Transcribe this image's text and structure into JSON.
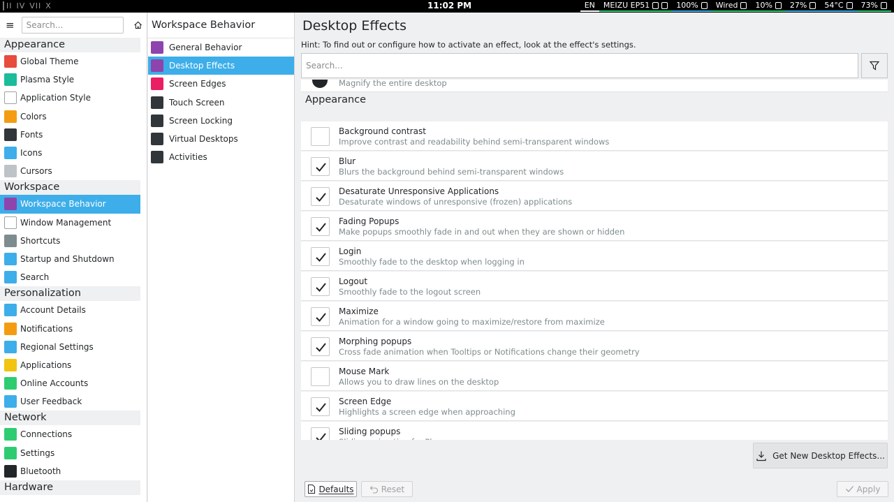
{
  "topbar": {
    "workspaces": [
      "II",
      "IV",
      "VII",
      "X"
    ],
    "clock": "11:02 PM",
    "tray": [
      {
        "name": "keyboard-layout",
        "text": "EN",
        "icon": "",
        "bar": "#ffffff"
      },
      {
        "name": "bluetooth-device",
        "text": "MEIZU EP51",
        "icon": "headset-icon bluetooth-icon",
        "bar": "#2ecc71"
      },
      {
        "name": "volume",
        "text": "100%",
        "icon": "speaker-icon",
        "bar": "#3daee9"
      },
      {
        "name": "network",
        "text": "Wired",
        "icon": "wired-icon",
        "bar": "#2ecc71"
      },
      {
        "name": "battery-device",
        "text": "10%",
        "icon": "battery-icon",
        "bar": "#2ecc71"
      },
      {
        "name": "memory",
        "text": "27%",
        "icon": "memory-icon",
        "bar": "#3daee9"
      },
      {
        "name": "temperature",
        "text": "54°C",
        "icon": "thermometer-icon",
        "bar": "#3daee9"
      },
      {
        "name": "battery",
        "text": "73%",
        "icon": "power-icon",
        "bar": "#2ecc71"
      }
    ]
  },
  "sidebar": {
    "search_placeholder": "Search...",
    "groups": [
      {
        "title": "Appearance",
        "items": [
          {
            "label": "Global Theme",
            "icon": "global-theme-icon",
            "color": "#e74c3c"
          },
          {
            "label": "Plasma Style",
            "icon": "plasma-style-icon",
            "color": "#1abc9c"
          },
          {
            "label": "Application Style",
            "icon": "application-style-icon",
            "color": "#ffffff"
          },
          {
            "label": "Colors",
            "icon": "colors-icon",
            "color": "#f39c12"
          },
          {
            "label": "Fonts",
            "icon": "fonts-icon",
            "color": "#31363b"
          },
          {
            "label": "Icons",
            "icon": "icons-icon",
            "color": "#3daee9"
          },
          {
            "label": "Cursors",
            "icon": "cursors-icon",
            "color": "#bdc3c7"
          }
        ]
      },
      {
        "title": "Workspace",
        "items": [
          {
            "label": "Workspace Behavior",
            "icon": "workspace-behavior-icon",
            "color": "#8e44ad",
            "selected": true
          },
          {
            "label": "Window Management",
            "icon": "window-management-icon",
            "color": "#ffffff"
          },
          {
            "label": "Shortcuts",
            "icon": "keyboard-icon",
            "color": "#7f8c8d"
          },
          {
            "label": "Startup and Shutdown",
            "icon": "startup-icon",
            "color": "#3daee9"
          },
          {
            "label": "Search",
            "icon": "search-icon",
            "color": "#3daee9"
          }
        ]
      },
      {
        "title": "Personalization",
        "items": [
          {
            "label": "Account Details",
            "icon": "account-icon",
            "color": "#3daee9"
          },
          {
            "label": "Notifications",
            "icon": "bell-icon",
            "color": "#f39c12"
          },
          {
            "label": "Regional Settings",
            "icon": "regional-icon",
            "color": "#3daee9"
          },
          {
            "label": "Applications",
            "icon": "star-icon",
            "color": "#f1c40f"
          },
          {
            "label": "Online Accounts",
            "icon": "globe-icon",
            "color": "#2ecc71"
          },
          {
            "label": "User Feedback",
            "icon": "feedback-icon",
            "color": "#3daee9"
          }
        ]
      },
      {
        "title": "Network",
        "items": [
          {
            "label": "Connections",
            "icon": "connections-globe-icon",
            "color": "#2ecc71"
          },
          {
            "label": "Settings",
            "icon": "network-settings-icon",
            "color": "#2ecc71"
          },
          {
            "label": "Bluetooth",
            "icon": "bluetooth-icon",
            "color": "#232629"
          }
        ]
      },
      {
        "title": "Hardware",
        "items": []
      }
    ]
  },
  "subnav": {
    "title": "Workspace Behavior",
    "items": [
      {
        "label": "General Behavior",
        "icon": "general-behavior-icon",
        "color": "#8e44ad"
      },
      {
        "label": "Desktop Effects",
        "icon": "desktop-effects-icon",
        "color": "#8e44ad",
        "selected": true
      },
      {
        "label": "Screen Edges",
        "icon": "screen-edges-icon",
        "color": "#e91e63"
      },
      {
        "label": "Touch Screen",
        "icon": "touch-screen-icon",
        "color": "#31363b"
      },
      {
        "label": "Screen Locking",
        "icon": "screen-locking-icon",
        "color": "#31363b"
      },
      {
        "label": "Virtual Desktops",
        "icon": "virtual-desktops-icon",
        "color": "#31363b"
      },
      {
        "label": "Activities",
        "icon": "activities-icon",
        "color": "#31363b"
      }
    ]
  },
  "main": {
    "title": "Desktop Effects",
    "hint": "Hint: To find out or configure how to activate an effect, look at the effect's settings.",
    "search_placeholder": "Search...",
    "prev_desc": "Magnify the entire desktop",
    "group": "Appearance",
    "effects": [
      {
        "name": "Background contrast",
        "desc": "Improve contrast and readability behind semi-transparent windows",
        "checked": false
      },
      {
        "name": "Blur",
        "desc": "Blurs the background behind semi-transparent windows",
        "checked": true
      },
      {
        "name": "Desaturate Unresponsive Applications",
        "desc": "Desaturate windows of unresponsive (frozen) applications",
        "checked": true
      },
      {
        "name": "Fading Popups",
        "desc": "Make popups smoothly fade in and out when they are shown or hidden",
        "checked": true
      },
      {
        "name": "Login",
        "desc": "Smoothly fade to the desktop when logging in",
        "checked": true
      },
      {
        "name": "Logout",
        "desc": "Smoothly fade to the logout screen",
        "checked": true
      },
      {
        "name": "Maximize",
        "desc": "Animation for a window going to maximize/restore from maximize",
        "checked": true
      },
      {
        "name": "Morphing popups",
        "desc": "Cross fade animation when Tooltips or Notifications change their geometry",
        "checked": true
      },
      {
        "name": "Mouse Mark",
        "desc": "Allows you to draw lines on the desktop",
        "checked": false
      },
      {
        "name": "Screen Edge",
        "desc": "Highlights a screen edge when approaching",
        "checked": true
      },
      {
        "name": "Sliding popups",
        "desc": "Sliding animation for Plasma popups",
        "checked": true
      }
    ],
    "get_new_label": "Get New Desktop Effects...",
    "defaults_label": "Defaults",
    "reset_label": "Reset",
    "apply_label": "Apply"
  }
}
